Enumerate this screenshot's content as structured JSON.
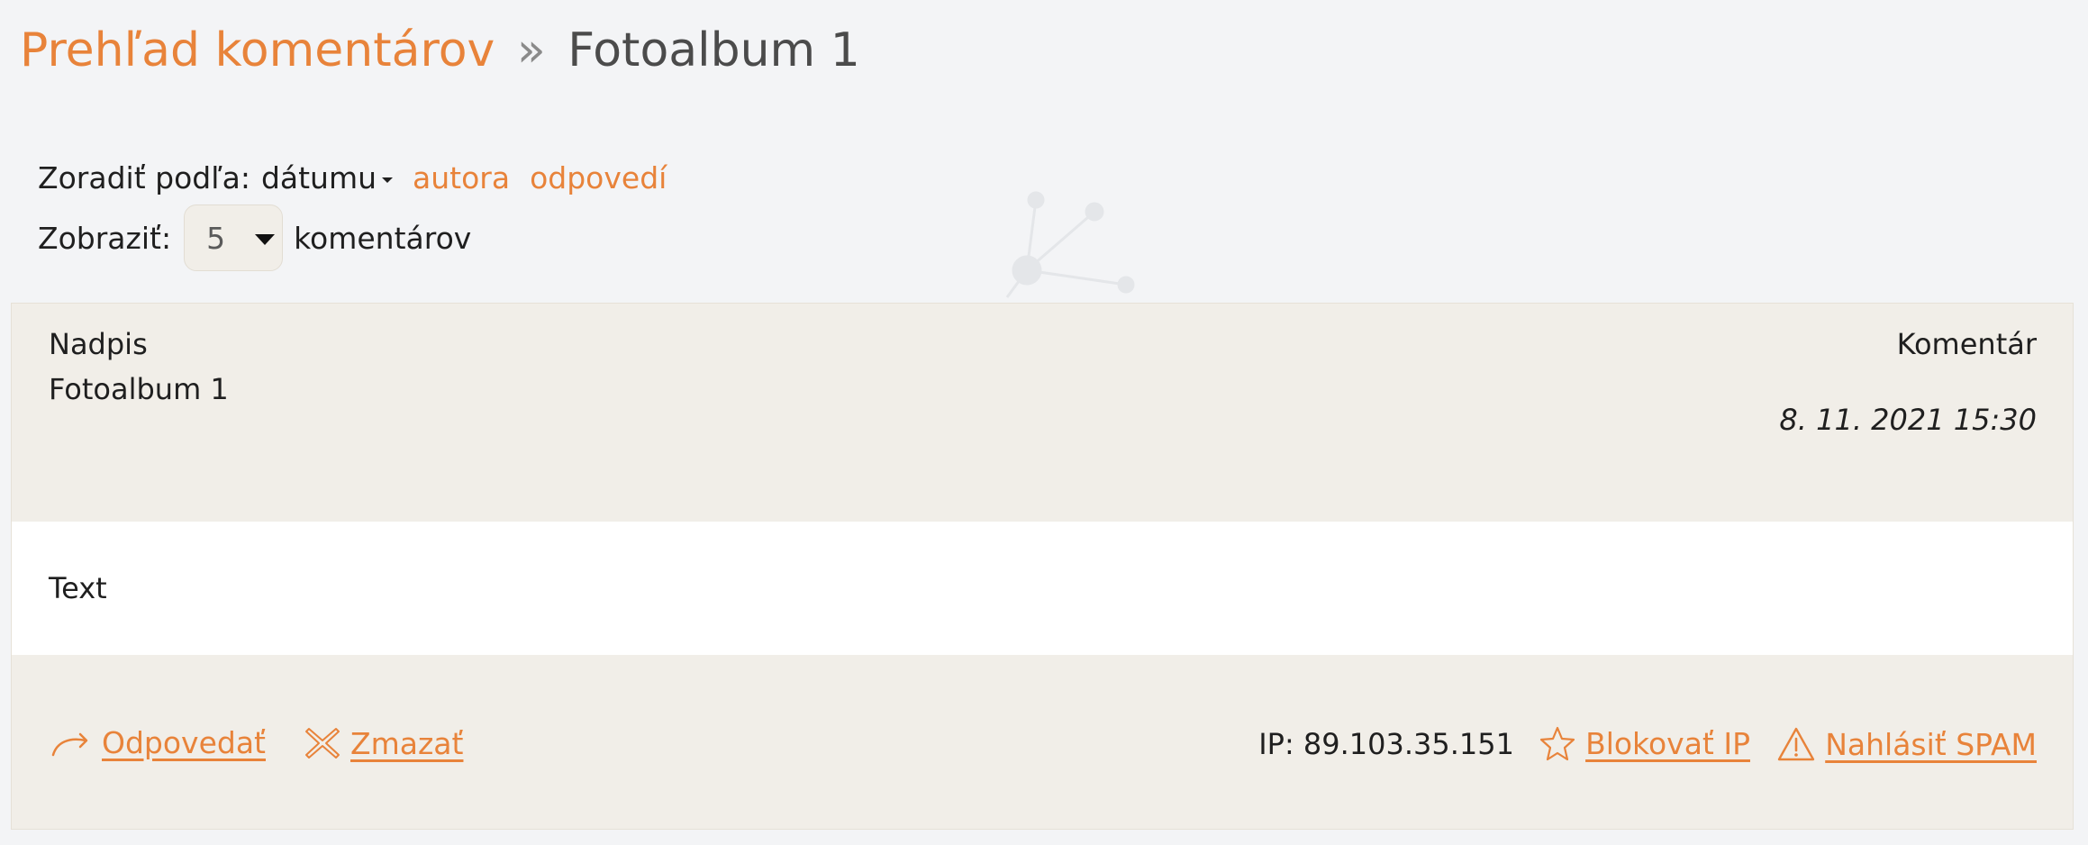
{
  "breadcrumb": {
    "parent": "Prehľad komentárov",
    "separator": "»",
    "current": "Fotoalbum 1"
  },
  "sort": {
    "label": "Zoradiť podľa:",
    "active": "dátumu",
    "options": [
      "autora",
      "odpovedí"
    ]
  },
  "display": {
    "label": "Zobraziť:",
    "selected": "5",
    "suffix": "komentárov"
  },
  "comment": {
    "title_label": "Nadpis",
    "title": "Fotoalbum 1",
    "type_label": "Komentár",
    "date": "8. 11. 2021 15:30",
    "text": "Text",
    "actions": {
      "reply": "Odpovedať",
      "delete": "Zmazať",
      "ip": "IP: 89.103.35.151",
      "block_ip": "Blokovať IP",
      "report_spam": "Nahlásiť SPAM"
    }
  },
  "colors": {
    "accent": "#e8833a",
    "page_bg": "#f3f4f6",
    "card_bg": "#f1eee8",
    "body_bg": "#ffffff"
  },
  "icons": {
    "reply": "reply-arrow-icon",
    "delete": "close-x-icon",
    "block_ip": "star-icon",
    "report_spam": "warning-triangle-icon"
  }
}
